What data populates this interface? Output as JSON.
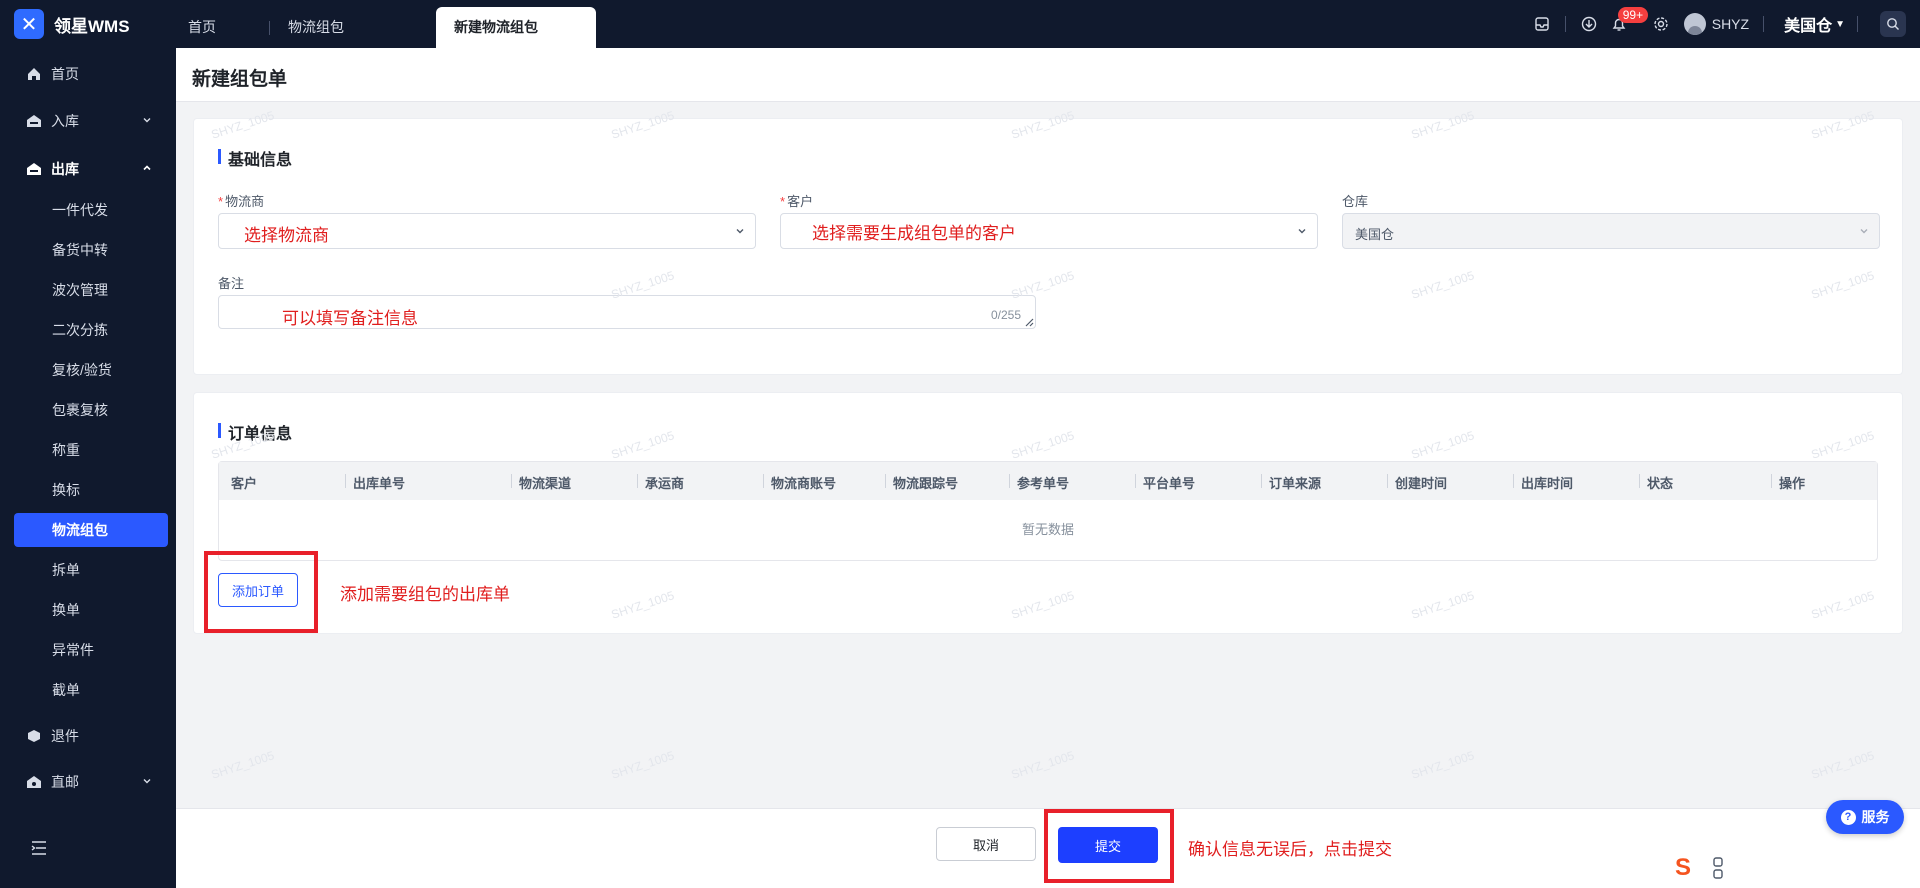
{
  "app": {
    "logo_text": "领星WMS"
  },
  "tabs": [
    {
      "label": "首页"
    },
    {
      "label": "物流组包"
    },
    {
      "label": "新建物流组包"
    }
  ],
  "topbar": {
    "notification_badge": "99+",
    "user_name": "SHYZ",
    "warehouse": "美国仓"
  },
  "sidebar": {
    "items": [
      {
        "label": "首页"
      },
      {
        "label": "入库"
      },
      {
        "label": "出库"
      },
      {
        "label": "退件"
      },
      {
        "label": "直邮"
      }
    ],
    "outbound_sub": [
      {
        "label": "一件代发"
      },
      {
        "label": "备货中转"
      },
      {
        "label": "波次管理"
      },
      {
        "label": "二次分拣"
      },
      {
        "label": "复核/验货"
      },
      {
        "label": "包裹复核"
      },
      {
        "label": "称重"
      },
      {
        "label": "换标"
      },
      {
        "label": "物流组包"
      },
      {
        "label": "拆单"
      },
      {
        "label": "换单"
      },
      {
        "label": "异常件"
      },
      {
        "label": "截单"
      }
    ]
  },
  "page": {
    "title": "新建组包单"
  },
  "basic": {
    "title": "基础信息",
    "required_mark": "*",
    "logistics_label": "物流商",
    "logistics_annotation": "选择物流商",
    "customer_label": "客户",
    "customer_annotation": "选择需要生成组包单的客户",
    "warehouse_label": "仓库",
    "warehouse_value": "美国仓",
    "remark_label": "备注",
    "remark_annotation": "可以填写备注信息",
    "remark_counter": "0/255"
  },
  "orders": {
    "title": "订单信息",
    "columns": [
      "客户",
      "出库单号",
      "物流渠道",
      "承运商",
      "物流商账号",
      "物流跟踪号",
      "参考单号",
      "平台单号",
      "订单来源",
      "创建时间",
      "出库时间",
      "状态",
      "操作"
    ],
    "empty_text": "暂无数据",
    "add_button": "添加订单",
    "add_annotation": "添加需要组包的出库单"
  },
  "footer": {
    "cancel_button": "取消",
    "submit_button": "提交",
    "submit_annotation": "确认信息无误后，点击提交"
  },
  "service": {
    "label": "服务",
    "icon": "?"
  },
  "watermark": "SHYZ_1005",
  "colors": {
    "primary": "#2b59ff",
    "annotation": "#e01e1e",
    "nav_bg": "#10192d"
  }
}
